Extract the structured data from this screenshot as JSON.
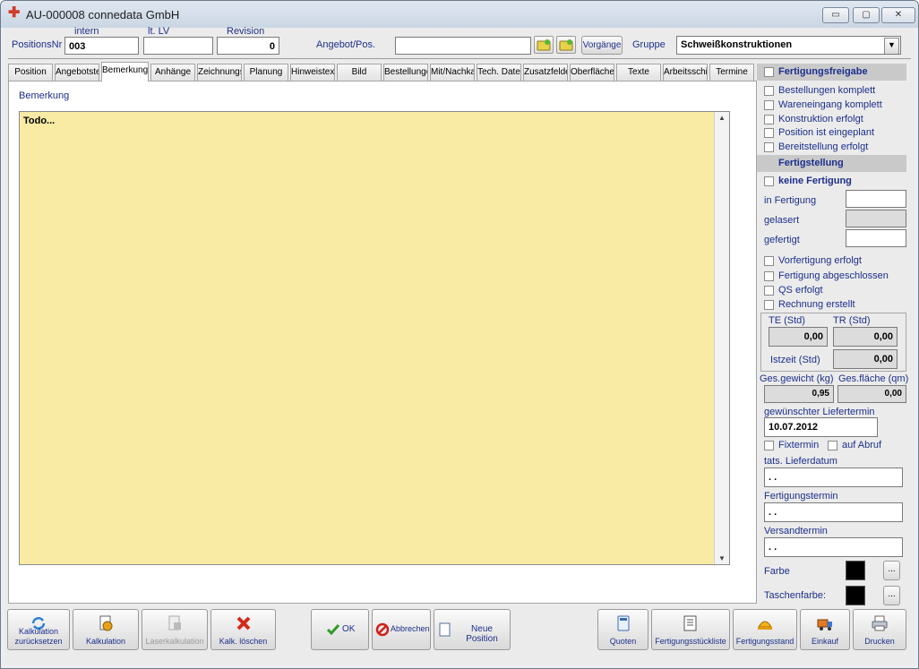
{
  "window": {
    "title": "AU-000008 connedata GmbH",
    "controls": {
      "minimize": "▭",
      "maximize": "▢",
      "close": "✕"
    }
  },
  "header": {
    "positionsnr_label": "PositionsNr",
    "positionsnr_value": "003",
    "intern_label": "intern",
    "intern_value": "",
    "ltlv_label": "lt. LV",
    "ltlv_value": "",
    "revision_label": "Revision",
    "revision_value": "0",
    "angebot_label": "Angebot/Pos.",
    "angebot_value": "",
    "vorgaenge_label": "Vorgänge",
    "gruppe_label": "Gruppe",
    "gruppe_value": "Schweißkonstruktionen"
  },
  "tabs": [
    {
      "label": "Position"
    },
    {
      "label": "Angebotste"
    },
    {
      "label": "Bemerkung",
      "active": true
    },
    {
      "label": "Anhänge"
    },
    {
      "label": "Zeichnungs"
    },
    {
      "label": "Planung"
    },
    {
      "label": "Hinweistex"
    },
    {
      "label": "Bild"
    },
    {
      "label": "Bestellunge"
    },
    {
      "label": "Mit/Nachka"
    },
    {
      "label": "Tech. Date"
    },
    {
      "label": "Zusatzfelde"
    },
    {
      "label": "Oberfläche"
    },
    {
      "label": "Texte"
    },
    {
      "label": "Arbeitsschi"
    },
    {
      "label": "Termine"
    }
  ],
  "memo": {
    "label": "Bemerkung",
    "text": "Todo..."
  },
  "right_panel": {
    "freigabe_header": "Fertigungsfreigabe",
    "freigabe_items": [
      "Bestellungen komplett",
      "Wareneingang komplett",
      "Konstruktion erfolgt",
      "Position ist eingeplant",
      "Bereitstellung erfolgt"
    ],
    "fertigstellung_header": "Fertigstellung",
    "keine_fertigung": "keine Fertigung",
    "in_fertigung_label": "in Fertigung",
    "gelasert_label": "gelasert",
    "gefertigt_label": "gefertigt",
    "status_items": [
      "Vorfertigung erfolgt",
      "Fertigung abgeschlossen",
      "QS erfolgt",
      "Rechnung erstellt"
    ],
    "te_label": "TE (Std)",
    "te_value": "0,00",
    "tr_label": "TR (Std)",
    "tr_value": "0,00",
    "istzeit_label": "Istzeit (Std)",
    "istzeit_value": "0,00",
    "gewicht_label": "Ges.gewicht (kg)",
    "gewicht_value": "0,95",
    "flaeche_label": "Ges.fläche (qm)",
    "flaeche_value": "0,00",
    "liefertermin_label": "gewünschter Liefertermin",
    "liefertermin_value": "10.07.2012",
    "fixtermin_label": "Fixtermin",
    "aufabruf_label": "auf Abruf",
    "tats_lieferdatum_label": "tats. Lieferdatum",
    "tats_lieferdatum_value": ". .",
    "fertigungstermin_label": "Fertigungstermin",
    "fertigungstermin_value": ". .",
    "versandtermin_label": "Versandtermin",
    "versandtermin_value": ". .",
    "farbe_label": "Farbe",
    "taschenfarbe_label": "Taschenfarbe:",
    "dots_label": "..."
  },
  "bottom_bar": {
    "kalk_reset": "Kalkulation zurücksetzen",
    "kalkulation": "Kalkulation",
    "laserkalkulation": "Laserkalkulation",
    "kalk_loeschen": "Kalk. löschen",
    "ok": "OK",
    "abbrechen": "Abbrechen",
    "neue_position": "Neue Position",
    "quoten": "Quoten",
    "stueckliste": "Fertigungsstückliste",
    "fertigungsstand": "Fertigungsstand",
    "einkauf": "Einkauf",
    "drucken": "Drucken"
  },
  "colors": {
    "memo_bg": "#faeba4",
    "label_blue": "#1c2f8c",
    "header_gray": "#c9c9c9"
  }
}
